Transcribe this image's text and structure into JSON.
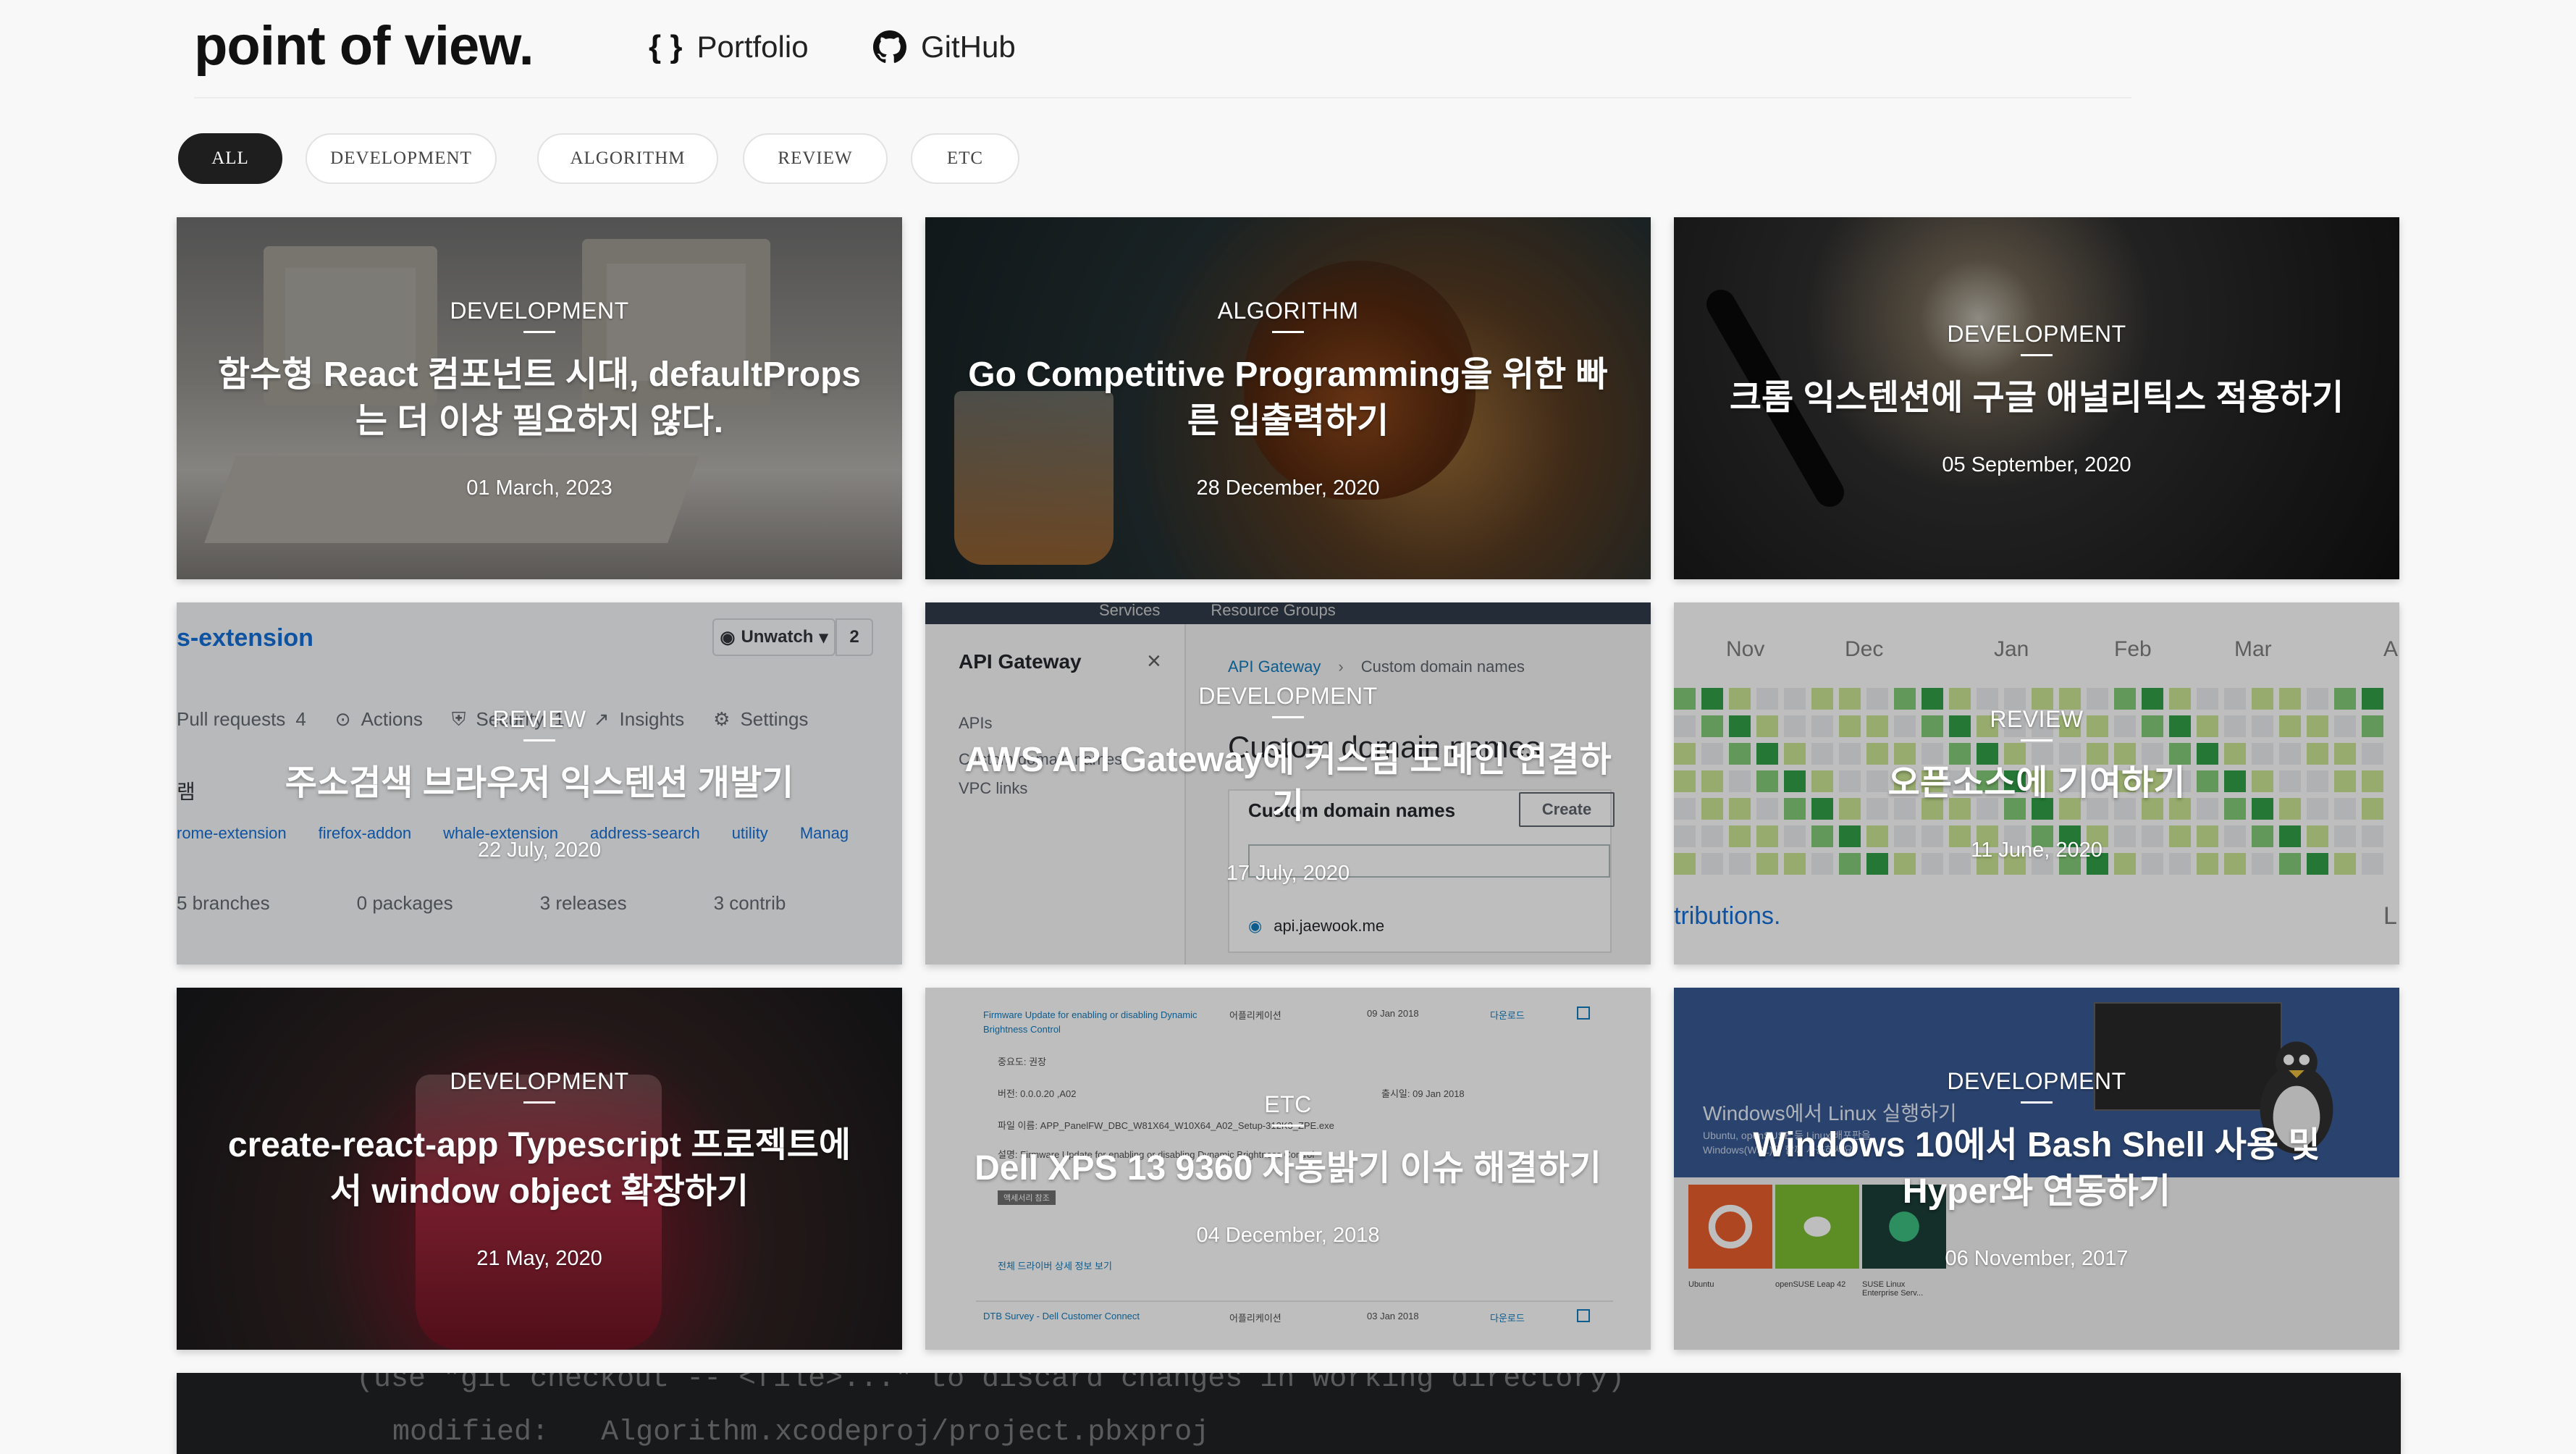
{
  "header": {
    "logo": "point of view.",
    "nav": [
      {
        "label": "Portfolio",
        "icon": "braces-icon"
      },
      {
        "label": "GitHub",
        "icon": "github-icon"
      }
    ]
  },
  "filters": [
    {
      "label": "ALL",
      "active": true
    },
    {
      "label": "DEVELOPMENT",
      "active": false
    },
    {
      "label": "ALGORITHM",
      "active": false
    },
    {
      "label": "REVIEW",
      "active": false
    },
    {
      "label": "ETC",
      "active": false
    }
  ],
  "posts": [
    {
      "category": "DEVELOPMENT",
      "title": "함수형 React 컴포넌트 시대, defaultProps는 더 이상 필요하지 않다.",
      "date": "01 March, 2023"
    },
    {
      "category": "ALGORITHM",
      "title": "Go Competitive Programming을 위한 빠른 입출력하기",
      "date": "28 December, 2020"
    },
    {
      "category": "DEVELOPMENT",
      "title": "크롬 익스텐션에 구글 애널리틱스 적용하기",
      "date": "05 September, 2020"
    },
    {
      "category": "REVIEW",
      "title": "주소검색 브라우저 익스텐션 개발기",
      "date": "22 July, 2020"
    },
    {
      "category": "DEVELOPMENT",
      "title": "AWS API Gateway에 커스텀 도메인 연결하기",
      "date": "17 July, 2020"
    },
    {
      "category": "REVIEW",
      "title": "오픈소스에 기여하기",
      "date": "11 June, 2020"
    },
    {
      "category": "DEVELOPMENT",
      "title": "create-react-app Typescript 프로젝트에서 window object 확장하기",
      "date": "21 May, 2020"
    },
    {
      "category": "ETC",
      "title": "Dell XPS 13 9360 자동밝기 이슈 해결하기",
      "date": "04 December, 2018"
    },
    {
      "category": "DEVELOPMENT",
      "title": "Windows 10에서 Bash Shell 사용 및 Hyper와 연동하기",
      "date": "06 November, 2017"
    }
  ],
  "thumbnails": {
    "github": {
      "repo": "s-extension",
      "watch": "Unwatch",
      "watch_count": "2",
      "tabs": [
        "Pull requests",
        "4",
        "Actions",
        "Security",
        "1",
        "Insights",
        "Settings"
      ],
      "topics": [
        "rome-extension",
        "firefox-addon",
        "whale-extension",
        "address-search",
        "utility",
        "Manag"
      ],
      "stats": [
        "5 branches",
        "0 packages",
        "3 releases",
        "3 contrib"
      ],
      "side_char": "램"
    },
    "aws": {
      "top": [
        "Services",
        "Resource Groups"
      ],
      "panel_title": "API Gateway",
      "side_items": [
        "APIs",
        "Custom domain names",
        "VPC links"
      ],
      "breadcrumb": [
        "API Gateway",
        "Custom domain names"
      ],
      "heading": "Custom domain names",
      "subheading": "Custom domain names",
      "button": "Create",
      "domain": "api.jaewook.me"
    },
    "contrib": {
      "months": [
        "Nov",
        "Dec",
        "Jan",
        "Feb",
        "Mar",
        "A"
      ],
      "footer": "tributions.",
      "footer_right": "L"
    },
    "dell": {
      "row1_title": "Firmware Update for enabling or disabling Dynamic Brightness Control",
      "row1_type": "어플리케이션",
      "row1_date": "09 Jan 2018",
      "download": "다운로드",
      "importance": "중요도: 권장",
      "version": "버전: 0.0.0.20 ,A02",
      "release": "출시일: 09 Jan 2018",
      "filename": "파일 이름: APP_PanelFW_DBC_W81X64_W10X64_A02_Setup-312K3_ZPE.exe",
      "desc": "설명: Firmware Update for enabling or disabling Dynamic Brightness Control",
      "badge": "액세서리 참조",
      "detail_link": "전체 드라이버 상세 정보 보기",
      "row2_title": "DTB Survey - Dell Customer Connect",
      "row2_type": "어플리케이션",
      "row2_date": "03 Jan 2018"
    },
    "windows": {
      "store_title": "Windows에서 Linux 실행하기",
      "store_sub": "Ubuntu, openSUSE 등 Linux 배포판을 Windows(WSL)과 함께 사용하세요.",
      "apps": [
        "Ubuntu",
        "openSUSE Leap 42",
        "SUSE Linux Enterprise Serv..."
      ]
    },
    "terminal": {
      "line1": "  (use \"git checkout -- <file>...\" to discard changes in working directory)",
      "line2": "        modified:   Algorithm.xcodeproj/project.pbxproj"
    }
  }
}
